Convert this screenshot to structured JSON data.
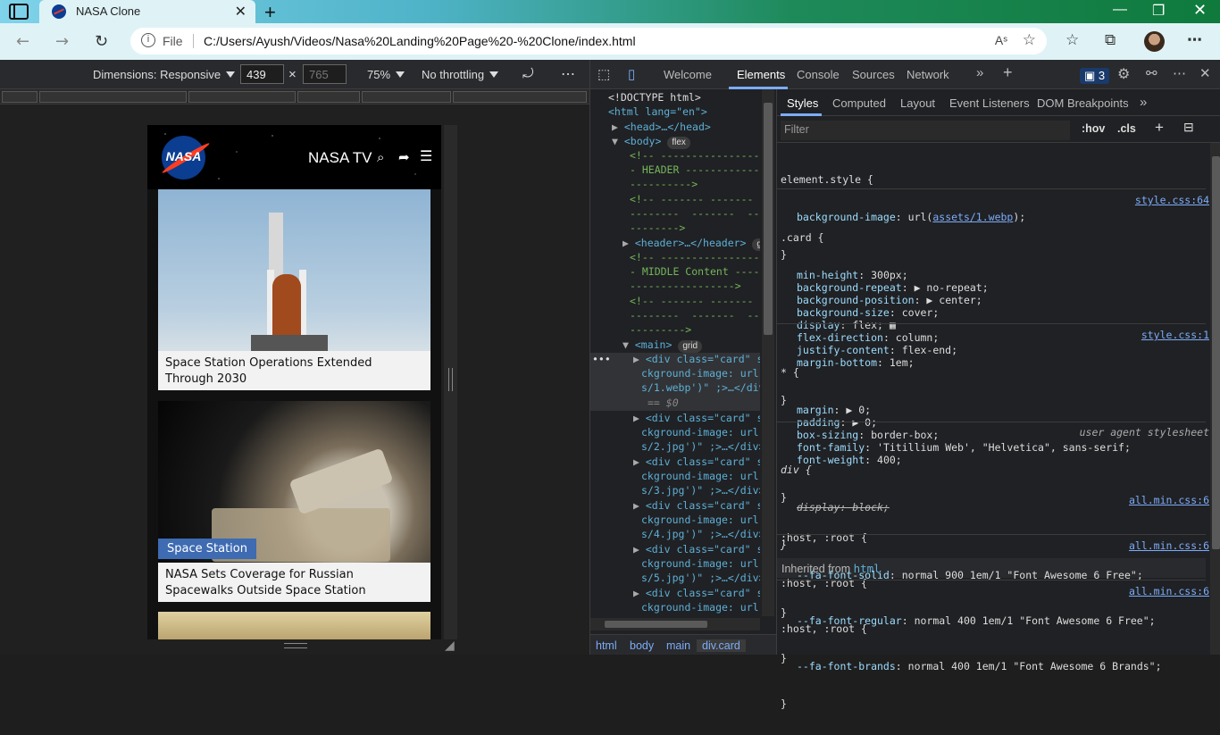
{
  "browser": {
    "tab_title": "NASA Clone",
    "new_tab": "+",
    "address": {
      "scheme_label": "File",
      "url": "C:/Users/Ayush/Videos/Nasa%20Landing%20Page%20-%20Clone/index.html"
    }
  },
  "device_toolbar": {
    "dimensions_label": "Dimensions: Responsive",
    "width_value": "439",
    "height_placeholder": "765",
    "times": "×",
    "zoom": "75%",
    "throttling": "No throttling",
    "more": "⋯"
  },
  "site": {
    "logo_text": "NASA",
    "nav_title": "NASA TV",
    "cards": [
      {
        "caption": "Space Station Operations Extended Through 2030",
        "tag": ""
      },
      {
        "caption": "NASA Sets Coverage for Russian Spacewalks Outside Space Station",
        "tag": "Space Station"
      }
    ]
  },
  "devtools": {
    "tabs": [
      "Welcome",
      "Elements",
      "Console",
      "Sources",
      "Network"
    ],
    "active_tab": "Elements",
    "issues_count": "3",
    "styles_tabs": [
      "Styles",
      "Computed",
      "Layout",
      "Event Listeners",
      "DOM Breakpoints"
    ],
    "filter_placeholder": "Filter",
    "hov": ":hov",
    "cls": ".cls",
    "inherited_label": "Inherited from",
    "inherited_from": "html",
    "breadcrumb": [
      "html",
      "body",
      "main",
      "div.card"
    ],
    "dom_lines": {
      "doctype": "<!DOCTYPE html>",
      "html_open": "<html lang=\"en\">",
      "head": "<head>…</head>",
      "body": "<body>",
      "flex": "flex",
      "grid": "grid",
      "c1": "<!-- -------------------",
      "c2": "- HEADER --------------",
      "c3": "---------->",
      "c4": "<!-- ------- ------- --",
      "c5": "--------  -------  ----",
      "c6": "-------->",
      "header": "<header>…</header>",
      "c7": "<!-- -------------------",
      "c8": "- MIDDLE Content -----",
      "c9": "----------------->",
      "c10": "<!-- ------- ------- --",
      "c11": "--------  -------  ----",
      "c12": "--------->",
      "main": "<main>",
      "d1a": "<div class=\"card\" st",
      "d1b": "ckground-image: url(",
      "d1c": "s/1.webp')\" ;>…</div",
      "d1d": "== $0",
      "d2a": "<div class=\"card\" st",
      "d2b": "ckground-image: url(",
      "d2c": "s/2.jpg')\" ;>…</div>",
      "d3a": "<div class=\"card\" st",
      "d3b": "ckground-image: url(",
      "d3c": "s/3.jpg')\" ;>…</div>",
      "d4a": "<div class=\"card\" st",
      "d4b": "ckground-image: url(",
      "d4c": "s/4.jpg')\" ;>…</div>",
      "d5a": "<div class=\"card\" st",
      "d5b": "ckground-image: url(",
      "d5c": "s/5.jpg')\" ;>…</div>",
      "d6a": "<div class=\"card\" st",
      "d6b": "ckground-image: url("
    },
    "styles": {
      "r1_sel": "element.style {",
      "r1_p1": "background-image",
      "r1_v1a": "url(",
      "r1_v1link": "assets/1.webp",
      "r1_v1b": ");",
      "r2_sel": ".card {",
      "r2_src": "style.css:64",
      "r2_props": [
        [
          "min-height",
          "300px;"
        ],
        [
          "background-repeat",
          "▶ no-repeat;"
        ],
        [
          "background-position",
          "▶ center;"
        ],
        [
          "background-size",
          "cover;"
        ],
        [
          "display",
          "flex; ▦"
        ],
        [
          "flex-direction",
          "column;"
        ],
        [
          "justify-content",
          "flex-end;"
        ],
        [
          "margin-bottom",
          "1em;"
        ]
      ],
      "r3_sel": "* {",
      "r3_src": "style.css:1",
      "r3_props": [
        [
          "margin",
          "▶ 0;"
        ],
        [
          "padding",
          "▶ 0;"
        ],
        [
          "box-sizing",
          "border-box;"
        ],
        [
          "font-family",
          "'Titillium Web', \"Helvetica\", sans-serif;"
        ],
        [
          "font-weight",
          "400;"
        ]
      ],
      "r4_sel": "div {",
      "r4_src": "user agent stylesheet",
      "r4_prop": "display: block;",
      "r5_sel": ":host, :root {",
      "r5_src": "all.min.css:6",
      "r5_p": "--fa-font-solid",
      "r5_v": "normal 900 1em/1 \"Font Awesome 6 Free\";",
      "r6_sel": ":host, :root {",
      "r6_src": "all.min.css:6",
      "r6_p": "--fa-font-regular",
      "r6_v": "normal 400 1em/1 \"Font Awesome 6 Free\";",
      "r7_sel": ":host, :root {",
      "r7_src": "all.min.css:6",
      "r7_p": "--fa-font-brands",
      "r7_v": "normal 400 1em/1 \"Font Awesome 6 Brands\";",
      "close": "}"
    }
  }
}
